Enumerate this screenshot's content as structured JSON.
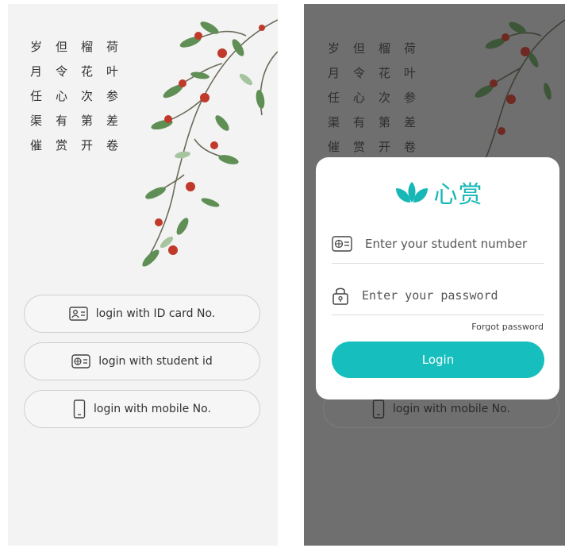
{
  "poem": {
    "characters": [
      "岁",
      "但",
      "榴",
      "荷",
      "月",
      "令",
      "花",
      "叶",
      "任",
      "心",
      "次",
      "参",
      "渠",
      "有",
      "第",
      "差",
      "催",
      "赏",
      "开",
      "卷"
    ]
  },
  "login_options": {
    "id_card_label": "login with ID card No.",
    "student_id_label": "login with student id",
    "mobile_label": "login with mobile No."
  },
  "modal": {
    "brand_name": "心赏",
    "student_number_placeholder": "Enter your student number",
    "password_placeholder": "Enter your password",
    "forgot_label": "Forgot password",
    "login_label": "Login"
  },
  "colors": {
    "accent": "#16bfbd",
    "overlay": "#6f6f6f"
  },
  "icons": [
    "id-card-icon",
    "student-card-icon",
    "mobile-icon",
    "lotus-logo-icon",
    "lock-icon"
  ]
}
